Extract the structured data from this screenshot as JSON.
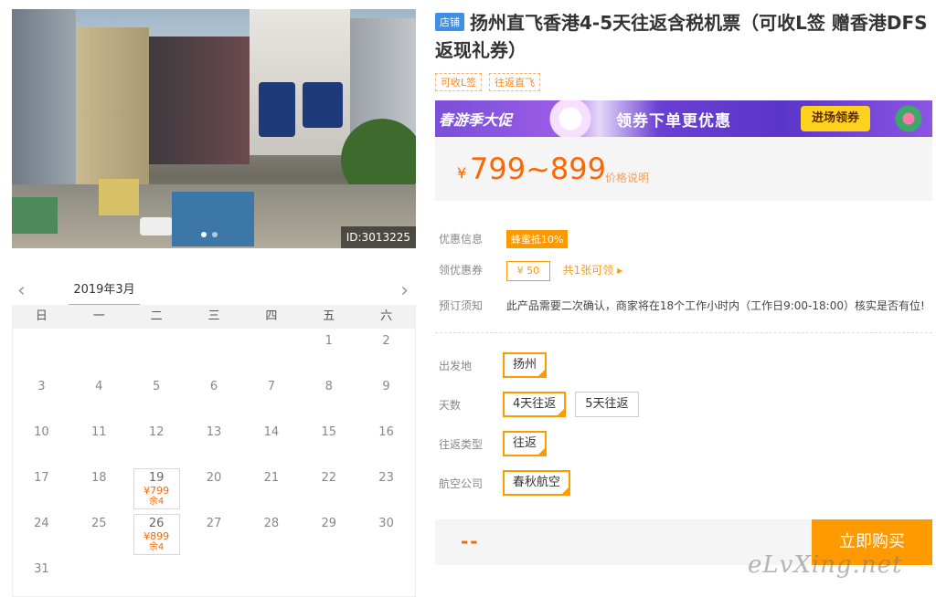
{
  "photo": {
    "id_text": "ID:3013225"
  },
  "calendar": {
    "month": "2019年3月",
    "weekdays": [
      "日",
      "一",
      "二",
      "三",
      "四",
      "五",
      "六"
    ],
    "days": [
      {
        "d": ""
      },
      {
        "d": ""
      },
      {
        "d": ""
      },
      {
        "d": ""
      },
      {
        "d": ""
      },
      {
        "d": "1"
      },
      {
        "d": "2"
      },
      {
        "d": "3"
      },
      {
        "d": "4"
      },
      {
        "d": "5"
      },
      {
        "d": "6"
      },
      {
        "d": "7"
      },
      {
        "d": "8"
      },
      {
        "d": "9"
      },
      {
        "d": "10"
      },
      {
        "d": "11"
      },
      {
        "d": "12"
      },
      {
        "d": "13"
      },
      {
        "d": "14"
      },
      {
        "d": "15"
      },
      {
        "d": "16"
      },
      {
        "d": "17"
      },
      {
        "d": "18"
      },
      {
        "d": "19",
        "price": "¥799",
        "stock": "余4"
      },
      {
        "d": "20"
      },
      {
        "d": "21"
      },
      {
        "d": "22"
      },
      {
        "d": "23"
      },
      {
        "d": "24"
      },
      {
        "d": "25"
      },
      {
        "d": "26",
        "price": "¥899",
        "stock": "余4"
      },
      {
        "d": "27"
      },
      {
        "d": "28"
      },
      {
        "d": "29"
      },
      {
        "d": "30"
      },
      {
        "d": "31"
      }
    ]
  },
  "product": {
    "shop_badge": "店铺",
    "title": "扬州直飞香港4-5天往返含税机票（可收L签 赠香港DFS返现礼券）",
    "tags": [
      "可收L签",
      "往返直飞"
    ]
  },
  "banner": {
    "left_text": "春游季大促",
    "mid_text": "领券下单更优惠",
    "btn_text": "进场领券"
  },
  "price": {
    "currency": "¥",
    "value": "799~899",
    "note": "价格说明"
  },
  "info": {
    "promo_label": "优惠信息",
    "promo_tag": "蜂蜜抵10%",
    "coupon_label": "领优惠券",
    "coupon_value": "¥ 50",
    "coupon_more": "共1张可领 ▸",
    "notice_label": "预订须知",
    "notice_text": "此产品需要二次确认，商家将在18个工作小时内（工作日9:00-18:00）核实是否有位!"
  },
  "options": {
    "departure_label": "出发地",
    "departure": [
      "扬州"
    ],
    "days_label": "天数",
    "days": [
      "4天往返",
      "5天往返"
    ],
    "trip_label": "往返类型",
    "trip": [
      "往返"
    ],
    "airline_label": "航空公司",
    "airline": [
      "春秋航空"
    ]
  },
  "buy": {
    "total": "--",
    "button": "立即购买"
  },
  "watermark": "eLvXing.net",
  "colors": {
    "accent": "#ff9900",
    "price": "#ff6600",
    "badge": "#3f8fe8"
  }
}
